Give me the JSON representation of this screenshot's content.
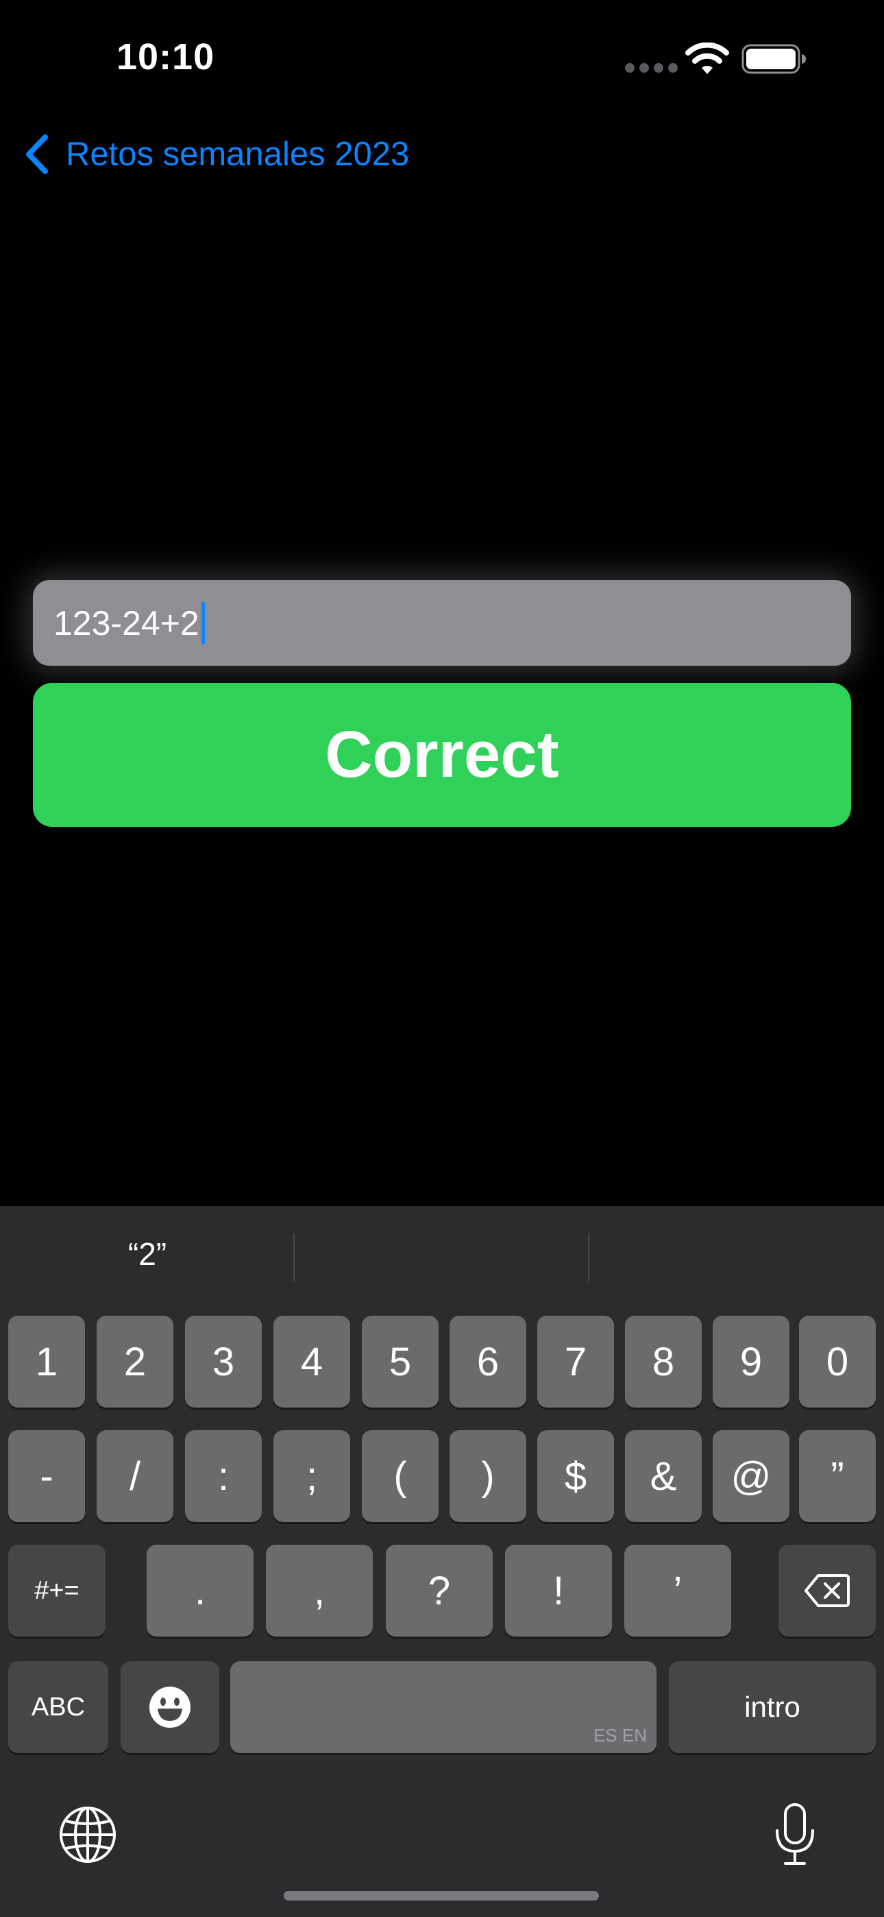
{
  "status_bar": {
    "time": "10:10"
  },
  "nav": {
    "back_label": "Retos semanales 2023"
  },
  "answer": {
    "value": "123-24+2"
  },
  "correct_button": {
    "label": "Correct"
  },
  "keyboard": {
    "suggestions": [
      "“2”",
      "",
      ""
    ],
    "row1": [
      "1",
      "2",
      "3",
      "4",
      "5",
      "6",
      "7",
      "8",
      "9",
      "0"
    ],
    "row2": [
      "-",
      "/",
      ":",
      ";",
      "(",
      ")",
      "$",
      "&",
      "@",
      "”"
    ],
    "row3": [
      "#+=",
      ".",
      ",",
      "?",
      "!",
      "’"
    ],
    "abc_label": "ABC",
    "space_language": "ES EN",
    "return_label": "intro"
  },
  "colors": {
    "accent": "#0a84ff",
    "success": "#30d158",
    "field": "#8e8e93",
    "keyboard_bg": "#2c2c2e"
  },
  "icons": {
    "back": "chevron-left-icon",
    "wifi": "wifi-icon",
    "battery": "battery-icon",
    "delete": "delete-backspace-icon",
    "emoji": "emoji-icon",
    "globe": "globe-icon",
    "microphone": "mic-icon"
  }
}
